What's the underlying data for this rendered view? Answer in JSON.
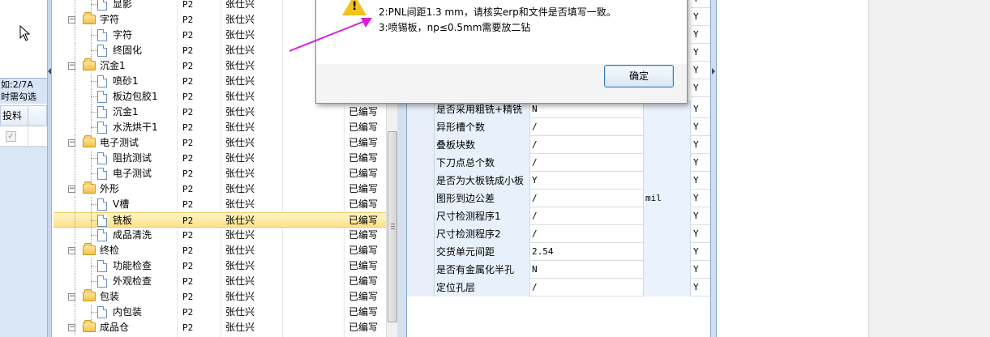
{
  "left_panel": {
    "hint_line1": "如:2/7A",
    "hint_line2": "时需勾选",
    "column_header": "投料"
  },
  "tree": {
    "rows": [
      {
        "name": "显影",
        "level": 2,
        "type": "doc",
        "c1": "P2",
        "c2": "张仕兴",
        "c3": ""
      },
      {
        "name": "字符",
        "level": 1,
        "type": "folder",
        "c1": "P2",
        "c2": "张仕兴",
        "c3": ""
      },
      {
        "name": "字符",
        "level": 2,
        "type": "doc",
        "c1": "P2",
        "c2": "张仕兴",
        "c3": ""
      },
      {
        "name": "终固化",
        "level": 2,
        "type": "doc",
        "c1": "P2",
        "c2": "张仕兴",
        "c3": ""
      },
      {
        "name": "沉金1",
        "level": 1,
        "type": "folder",
        "c1": "P2",
        "c2": "张仕兴",
        "c3": ""
      },
      {
        "name": "喷砂1",
        "level": 2,
        "type": "doc",
        "c1": "P2",
        "c2": "张仕兴",
        "c3": ""
      },
      {
        "name": "板边包胶1",
        "level": 2,
        "type": "doc",
        "c1": "P2",
        "c2": "张仕兴",
        "c3": ""
      },
      {
        "name": "沉金1",
        "level": 2,
        "type": "doc",
        "c1": "P2",
        "c2": "张仕兴",
        "c3": "已编写"
      },
      {
        "name": "水洗烘干1",
        "level": 2,
        "type": "doc",
        "c1": "P2",
        "c2": "张仕兴",
        "c3": "已编写"
      },
      {
        "name": "电子测试",
        "level": 1,
        "type": "folder",
        "c1": "P2",
        "c2": "张仕兴",
        "c3": "已编写"
      },
      {
        "name": "阻抗测试",
        "level": 2,
        "type": "doc",
        "c1": "P2",
        "c2": "张仕兴",
        "c3": "已编写"
      },
      {
        "name": "电子测试",
        "level": 2,
        "type": "doc",
        "c1": "P2",
        "c2": "张仕兴",
        "c3": "已编写"
      },
      {
        "name": "外形",
        "level": 1,
        "type": "folder",
        "c1": "P2",
        "c2": "张仕兴",
        "c3": "已编写"
      },
      {
        "name": "V槽",
        "level": 2,
        "type": "doc",
        "c1": "P2",
        "c2": "张仕兴",
        "c3": "已编写"
      },
      {
        "name": "铣板",
        "level": 2,
        "type": "doc",
        "c1": "P2",
        "c2": "张仕兴",
        "c3": "已编写",
        "selected": true
      },
      {
        "name": "成品清洗",
        "level": 2,
        "type": "doc",
        "c1": "P2",
        "c2": "张仕兴",
        "c3": "已编写"
      },
      {
        "name": "终检",
        "level": 1,
        "type": "folder",
        "c1": "P2",
        "c2": "张仕兴",
        "c3": "已编写"
      },
      {
        "name": "功能检查",
        "level": 2,
        "type": "doc",
        "c1": "P2",
        "c2": "张仕兴",
        "c3": "已编写"
      },
      {
        "name": "外观检查",
        "level": 2,
        "type": "doc",
        "c1": "P2",
        "c2": "张仕兴",
        "c3": "已编写"
      },
      {
        "name": "包装",
        "level": 1,
        "type": "folder",
        "c1": "P2",
        "c2": "张仕兴",
        "c3": "已编写"
      },
      {
        "name": "内包装",
        "level": 2,
        "type": "doc",
        "c1": "P2",
        "c2": "张仕兴",
        "c3": "已编写"
      },
      {
        "name": "成品仓",
        "level": 1,
        "type": "folder",
        "c1": "P2",
        "c2": "张仕兴",
        "c3": "已编写"
      }
    ]
  },
  "grid_top_flags": [
    "Y",
    "Y",
    "Y",
    "Y",
    "Y",
    "Y"
  ],
  "grid": {
    "rows": [
      {
        "label": "是否采用粗铣+精铣",
        "value": "N",
        "unit": "",
        "flag": "Y"
      },
      {
        "label": "异形槽个数",
        "value": "/",
        "unit": "",
        "flag": "Y"
      },
      {
        "label": "叠板块数",
        "value": "/",
        "unit": "",
        "flag": "Y"
      },
      {
        "label": "下刀点总个数",
        "value": "/",
        "unit": "",
        "flag": "Y"
      },
      {
        "label": "是否为大板铣成小板",
        "value": "Y",
        "unit": "",
        "flag": "Y"
      },
      {
        "label": "图形到边公差",
        "value": "/",
        "unit": "mil",
        "flag": "Y"
      },
      {
        "label": "尺寸检测程序1",
        "value": "/",
        "unit": "",
        "flag": "Y"
      },
      {
        "label": "尺寸检测程序2",
        "value": "/",
        "unit": "",
        "flag": "Y"
      },
      {
        "label": "交货单元间距",
        "value": "2.54",
        "unit": "",
        "flag": "Y"
      },
      {
        "label": "是否有金属化半孔",
        "value": "N",
        "unit": "",
        "flag": "Y"
      },
      {
        "label": "定位孔层",
        "value": "/",
        "unit": "",
        "flag": "Y"
      }
    ]
  },
  "dialog": {
    "message_line1": "2:PNL间距1.3 mm，请核实erp和文件是否填写一致。",
    "message_line2": "3:喷锡板，np≤0.5mm需要放二钻",
    "ok_label": "确定",
    "icon": "warning-icon"
  },
  "colors": {
    "selection": "#ffe08a",
    "arrow": "#d81ed8",
    "grid_label_bg": "#e8f0fb",
    "panel_blue": "#d8e6f5"
  }
}
